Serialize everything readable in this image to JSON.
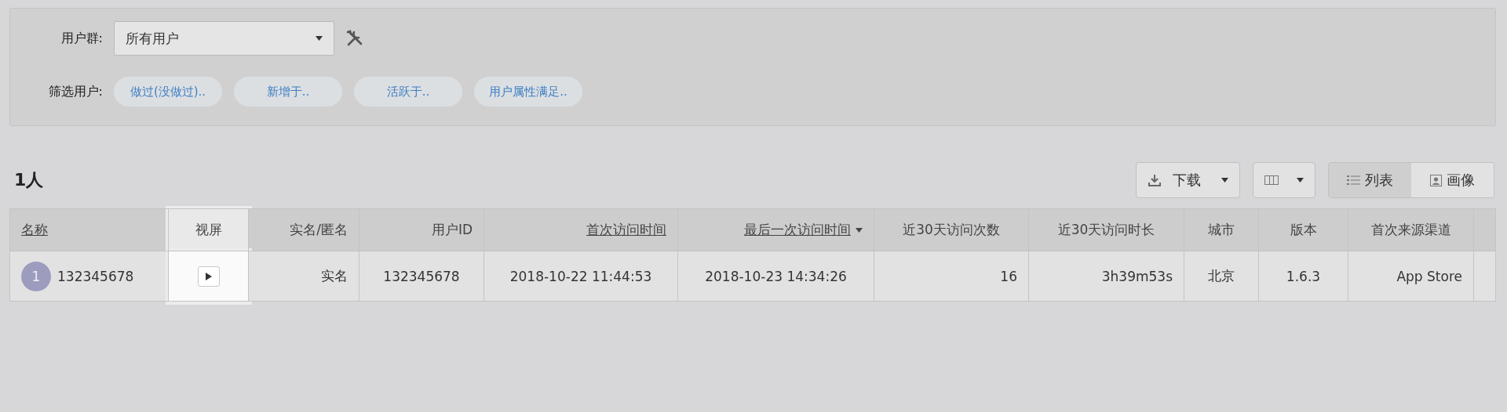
{
  "filter_panel": {
    "group_label": "用户群:",
    "group_select": {
      "value": "所有用户"
    },
    "filter_label": "筛选用户:",
    "filters": [
      "做过(没做过)..",
      "新增于..",
      "活跃于..",
      "用户属性满足.."
    ]
  },
  "result_count": "1人",
  "toolbar": {
    "download": "下载",
    "views": [
      {
        "label": "列表",
        "kind": "list",
        "selected": true
      },
      {
        "label": "画像",
        "kind": "portrait",
        "selected": false
      }
    ]
  },
  "table": {
    "columns": [
      {
        "label": "名称",
        "sortable": true,
        "sorted": false,
        "highlighted": false
      },
      {
        "label": "视屏",
        "sortable": false,
        "sorted": false,
        "highlighted": true
      },
      {
        "label": "实名/匿名",
        "sortable": false,
        "sorted": false,
        "highlighted": false
      },
      {
        "label": "用户ID",
        "sortable": false,
        "sorted": false,
        "highlighted": false
      },
      {
        "label": "首次访问时间",
        "sortable": true,
        "sorted": false,
        "highlighted": false
      },
      {
        "label": "最后一次访问时间",
        "sortable": true,
        "sorted": true,
        "highlighted": false
      },
      {
        "label": "近30天访问次数",
        "sortable": false,
        "sorted": false,
        "highlighted": false
      },
      {
        "label": "近30天访问时长",
        "sortable": false,
        "sorted": false,
        "highlighted": false
      },
      {
        "label": "城市",
        "sortable": false,
        "sorted": false,
        "highlighted": false
      },
      {
        "label": "版本",
        "sortable": false,
        "sorted": false,
        "highlighted": false
      },
      {
        "label": "首次来源渠道",
        "sortable": false,
        "sorted": false,
        "highlighted": false
      }
    ],
    "rows": [
      {
        "avatar": "1",
        "name": "132345678",
        "identity": "实名",
        "user_id": "132345678",
        "first_visit": "2018-10-22 11:44:53",
        "last_visit": "2018-10-23 14:34:26",
        "visits_30d": "16",
        "duration_30d": "3h39m53s",
        "city": "北京",
        "version": "1.6.3",
        "source": "App Store"
      }
    ]
  }
}
